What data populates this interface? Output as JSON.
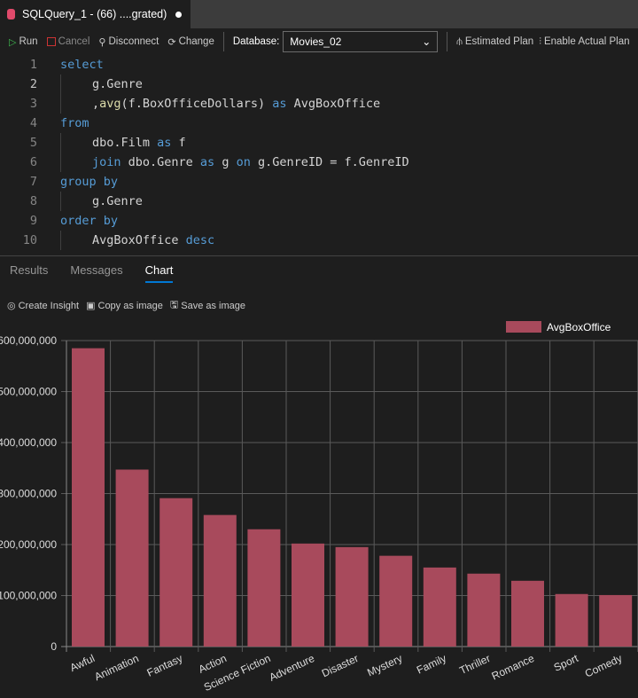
{
  "tab": {
    "title": "SQLQuery_1 - (66) ....grated)",
    "icon": "database-icon",
    "unsaved": true
  },
  "toolbar": {
    "run": "Run",
    "cancel": "Cancel",
    "disconnect": "Disconnect",
    "change": "Change",
    "database_label": "Database:",
    "database": "Movies_02",
    "estimated_plan": "Estimated Plan",
    "actual_plan": "Enable Actual Plan"
  },
  "editor": {
    "current_line": 2,
    "lines": [
      {
        "n": "1",
        "indent": 0,
        "tokens": [
          [
            "kw",
            "select"
          ]
        ]
      },
      {
        "n": "2",
        "indent": 1,
        "tokens": [
          [
            "",
            "g.Genre"
          ]
        ]
      },
      {
        "n": "3",
        "indent": 1,
        "tokens": [
          [
            "",
            ","
          ],
          [
            "fn",
            "avg"
          ],
          [
            "",
            "(f.BoxOfficeDollars) "
          ],
          [
            "kw",
            "as"
          ],
          [
            "",
            " AvgBoxOffice"
          ]
        ]
      },
      {
        "n": "4",
        "indent": 0,
        "tokens": [
          [
            "kw",
            "from"
          ]
        ]
      },
      {
        "n": "5",
        "indent": 1,
        "tokens": [
          [
            "",
            "dbo.Film "
          ],
          [
            "kw",
            "as"
          ],
          [
            "",
            " f"
          ]
        ]
      },
      {
        "n": "6",
        "indent": 1,
        "tokens": [
          [
            "kw",
            "join"
          ],
          [
            "",
            " dbo.Genre "
          ],
          [
            "kw",
            "as"
          ],
          [
            "",
            " g "
          ],
          [
            "kw",
            "on"
          ],
          [
            "",
            " g.GenreID = f.GenreID"
          ]
        ]
      },
      {
        "n": "7",
        "indent": 0,
        "tokens": [
          [
            "kw",
            "group by"
          ]
        ]
      },
      {
        "n": "8",
        "indent": 1,
        "tokens": [
          [
            "",
            "g.Genre"
          ]
        ]
      },
      {
        "n": "9",
        "indent": 0,
        "tokens": [
          [
            "kw",
            "order by"
          ]
        ]
      },
      {
        "n": "10",
        "indent": 1,
        "tokens": [
          [
            "",
            "AvgBoxOffice "
          ],
          [
            "kw",
            "desc"
          ]
        ]
      }
    ]
  },
  "results_tabs": [
    "Results",
    "Messages",
    "Chart"
  ],
  "active_tab": "Chart",
  "chart_actions": {
    "insight": "Create Insight",
    "copy": "Copy as image",
    "save": "Save as image"
  },
  "chart_data": {
    "type": "bar",
    "categories": [
      "Awful",
      "Animation",
      "Fantasy",
      "Action",
      "Science Fiction",
      "Adventure",
      "Disaster",
      "Mystery",
      "Family",
      "Thriller",
      "Romance",
      "Sport",
      "Comedy"
    ],
    "series": [
      {
        "name": "AvgBoxOffice",
        "color": "#a84a5c",
        "values": [
          585000000,
          347000000,
          291000000,
          258000000,
          230000000,
          202000000,
          195000000,
          178000000,
          155000000,
          143000000,
          129000000,
          103000000,
          101000000
        ]
      }
    ],
    "ylim": [
      0,
      600000000
    ],
    "yticks": [
      "0",
      "100,000,000",
      "200,000,000",
      "300,000,000",
      "400,000,000",
      "500,000,000",
      "600,000,000"
    ],
    "grid": true,
    "legend": "top-right"
  }
}
